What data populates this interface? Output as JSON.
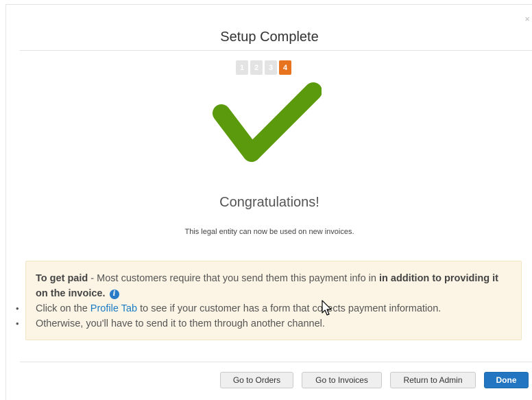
{
  "dialog": {
    "title": "Setup Complete",
    "close_symbol": "×",
    "steps": [
      "1",
      "2",
      "3",
      "4"
    ],
    "active_step": "4",
    "success_icon": "checkmark-icon",
    "success_color": "#5a9a0c",
    "heading": "Congratulations!",
    "subtext": "This legal entity can now be used on new invoices."
  },
  "info": {
    "bold_lead": "To get paid",
    "lead_rest": " - Most customers require that you send them this payment info in ",
    "bold_tail": "in addition to providing it on the invoice.",
    "info_icon": "i",
    "bullet1_pre": "Click on the ",
    "bullet1_link": "Profile Tab",
    "bullet1_post": " to see if your customer has a form that collects payment information.",
    "bullet2": "Otherwise, you'll have to send it to them through another channel."
  },
  "footer": {
    "go_to_orders": "Go to Orders",
    "go_to_invoices": "Go to Invoices",
    "return_to_admin": "Return to Admin",
    "done": "Done"
  },
  "colors": {
    "accent_orange": "#e8731f",
    "primary_blue": "#2275c0",
    "link_blue": "#1a7bc4",
    "info_bg": "#fcf5e5"
  }
}
